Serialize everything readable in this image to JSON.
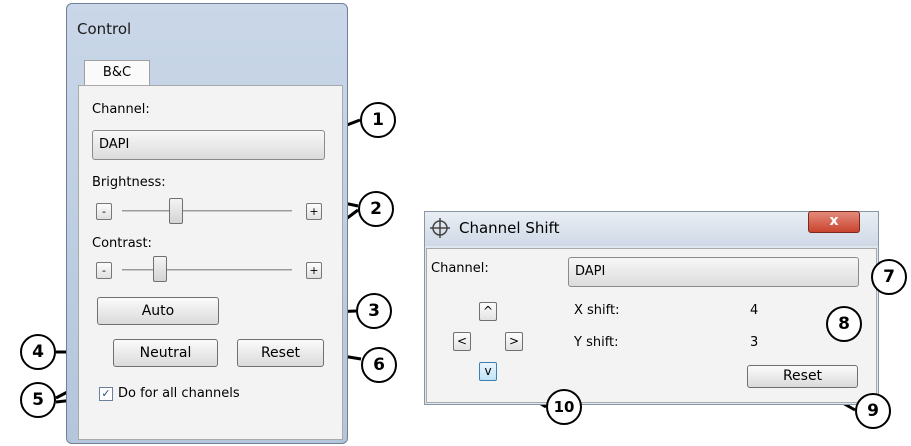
{
  "control": {
    "title": "Control",
    "tab_label": "B&C",
    "channel_label": "Channel:",
    "channel_value": "DAPI",
    "brightness_label": "Brightness:",
    "brightness_level": 0.3,
    "contrast_label": "Contrast:",
    "contrast_level": 0.2,
    "minus": "-",
    "plus": "+",
    "auto_label": "Auto",
    "neutral_label": "Neutral",
    "reset_label": "Reset",
    "checkbox_checked": true,
    "checkbox_mark": "✓",
    "checkbox_label": "Do for all channels"
  },
  "channel_shift": {
    "title": "Channel Shift",
    "close_glyph": "x",
    "channel_label": "Channel:",
    "channel_value": "DAPI",
    "up": "^",
    "left": "<",
    "right": ">",
    "down": "v",
    "x_shift_label": "X shift:",
    "x_shift_value": "4",
    "y_shift_label": "Y shift:",
    "y_shift_value": "3",
    "reset_label": "Reset"
  },
  "callouts": [
    "1",
    "2",
    "3",
    "4",
    "5",
    "6",
    "7",
    "8",
    "9",
    "10"
  ]
}
